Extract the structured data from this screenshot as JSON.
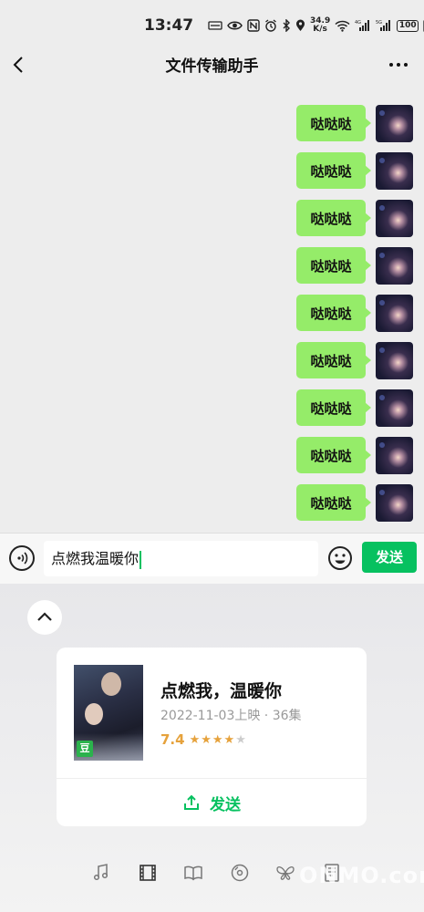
{
  "status_bar": {
    "time": "13:47",
    "net_speed_value": "34.9",
    "net_speed_unit": "K/s",
    "battery": "100"
  },
  "nav": {
    "title": "文件传输助手"
  },
  "messages": [
    {
      "text": "哒哒哒"
    },
    {
      "text": "哒哒哒"
    },
    {
      "text": "哒哒哒"
    },
    {
      "text": "哒哒哒"
    },
    {
      "text": "哒哒哒"
    },
    {
      "text": "哒哒哒"
    },
    {
      "text": "哒哒哒"
    },
    {
      "text": "哒哒哒"
    },
    {
      "text": "哒哒哒"
    }
  ],
  "input": {
    "value": "点燃我温暖你",
    "send_label": "发送"
  },
  "card": {
    "title": "点燃我，温暖你",
    "meta": "2022-11-03上映 · 36集",
    "rating": "7.4",
    "stars": 3.7,
    "badge": "豆",
    "send_label": "发送"
  },
  "bottom_tabs": [
    "music-icon",
    "film-icon",
    "book-icon",
    "vinyl-icon",
    "butterfly-icon",
    "document-icon"
  ],
  "watermark": "ONMO.com",
  "colors": {
    "accent": "#07c160",
    "bubble": "#95ec69",
    "rating": "#e6a23c"
  }
}
